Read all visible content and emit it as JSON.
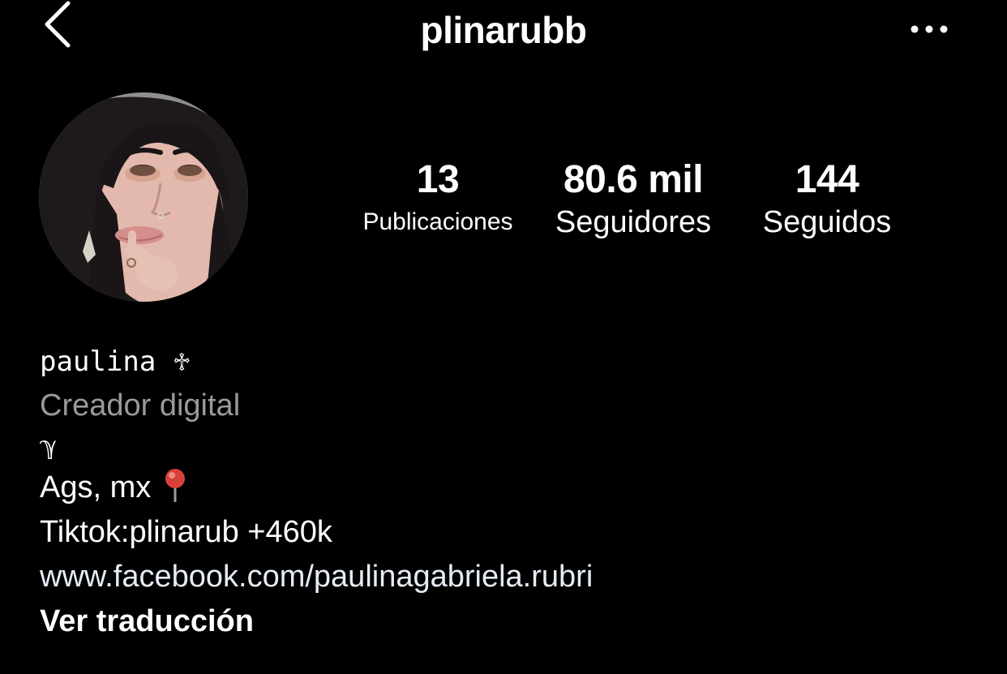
{
  "header": {
    "username": "plinarubb",
    "back_icon": "chevron-left-icon",
    "more_icon": "more-horizontal-icon"
  },
  "stats": {
    "posts": {
      "value": "13",
      "label": "Publicaciones"
    },
    "followers": {
      "value": "80.6 mil",
      "label": "Seguidores"
    },
    "following": {
      "value": "144",
      "label": "Seguidos"
    }
  },
  "bio": {
    "name": "paulina",
    "name_symbol": "♱",
    "category": "Creador digital",
    "glyph_line": "ℽ",
    "location": "Ags, mx",
    "location_icon": "pushpin-icon",
    "tiktok": "Tiktok:plinarub +460k",
    "link": "www.facebook.com/paulinagabriela.rubri",
    "translate": "Ver traducción"
  },
  "colors": {
    "background": "#000000",
    "text": "#ffffff",
    "secondary_text": "#9a9a9a",
    "link_text": "#e6ecf5",
    "pin_red": "#d8413a"
  }
}
